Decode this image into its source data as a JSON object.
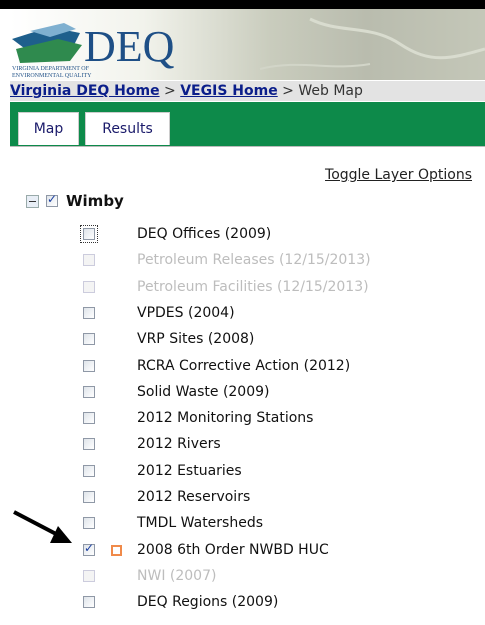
{
  "header": {
    "logo_text": "DEQ",
    "logo_sub1": "VIRGINIA DEPARTMENT OF",
    "logo_sub2": "ENVIRONMENTAL QUALITY"
  },
  "breadcrumb": {
    "home": "Virginia DEQ Home",
    "sep1": " > ",
    "vegis": "VEGIS Home",
    "sep2": " > ",
    "current": "Web Map"
  },
  "tabs": [
    {
      "label": "Map",
      "active": true
    },
    {
      "label": "Results",
      "active": false
    }
  ],
  "toggle_label": "Toggle Layer Options",
  "root": {
    "label": "Wimby",
    "checked": true
  },
  "layers": [
    {
      "label": "DEQ Offices (2009)",
      "checked": false,
      "enabled": true
    },
    {
      "label": "Petroleum Releases (12/15/2013)",
      "checked": false,
      "enabled": false
    },
    {
      "label": "Petroleum Facilities (12/15/2013)",
      "checked": false,
      "enabled": false
    },
    {
      "label": "VPDES (2004)",
      "checked": false,
      "enabled": true
    },
    {
      "label": "VRP Sites (2008)",
      "checked": false,
      "enabled": true
    },
    {
      "label": "RCRA Corrective Action (2012)",
      "checked": false,
      "enabled": true
    },
    {
      "label": "Solid Waste (2009)",
      "checked": false,
      "enabled": true
    },
    {
      "label": "2012 Monitoring Stations",
      "checked": false,
      "enabled": true
    },
    {
      "label": "2012 Rivers",
      "checked": false,
      "enabled": true
    },
    {
      "label": "2012 Estuaries",
      "checked": false,
      "enabled": true
    },
    {
      "label": "2012 Reservoirs",
      "checked": false,
      "enabled": true
    },
    {
      "label": "TMDL Watersheds",
      "checked": false,
      "enabled": true
    },
    {
      "label": "2008 6th Order NWBD HUC",
      "checked": true,
      "enabled": true,
      "swatch": "#f08a4a"
    },
    {
      "label": "NWI (2007)",
      "checked": false,
      "enabled": false
    },
    {
      "label": "DEQ Regions (2009)",
      "checked": false,
      "enabled": true
    }
  ],
  "colors": {
    "tab_bar": "#0d8a4a",
    "link": "#0b1e8a",
    "disabled_text": "#bdbdbd"
  }
}
